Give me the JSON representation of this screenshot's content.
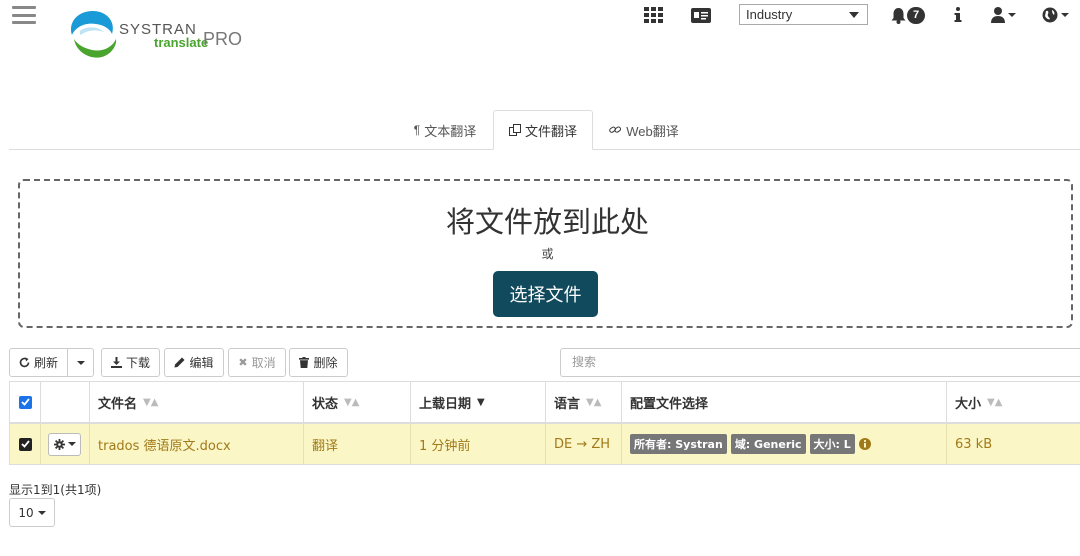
{
  "header": {
    "logo": {
      "brand": "SYSTRAN",
      "sub": "translate",
      "pro": "PRO"
    },
    "domain_select": {
      "value": "Industry"
    },
    "notifications_count": "7"
  },
  "tabs": [
    {
      "label": "文本翻译",
      "icon": "paragraph-icon",
      "active": false
    },
    {
      "label": "文件翻译",
      "icon": "copy-icon",
      "active": true
    },
    {
      "label": "Web翻译",
      "icon": "link-icon",
      "active": false
    }
  ],
  "dropzone": {
    "title": "将文件放到此处",
    "or": "或",
    "button": "选择文件"
  },
  "toolbar": {
    "refresh": "刷新",
    "download": "下载",
    "edit": "编辑",
    "cancel": "取消",
    "delete": "删除",
    "search_placeholder": "搜索"
  },
  "table": {
    "columns": [
      "文件名",
      "状态",
      "上载日期",
      "语言",
      "配置文件选择",
      "大小"
    ],
    "rows": [
      {
        "filename": "trados 德语原文.docx",
        "status": "翻译",
        "uploaded": "1 分钟前",
        "language": "DE → ZH",
        "profile_tags": [
          "所有者: Systran",
          "域: Generic",
          "大小: L"
        ],
        "size": "63 kB"
      }
    ]
  },
  "footer": {
    "summary": "显示1到1(共1项)",
    "page_size": "10"
  },
  "colors": {
    "primary_button": "#114a5c",
    "row_highlight": "#fbf6c6",
    "row_text": "#a07a1a",
    "logo_green": "#4aa52e"
  }
}
